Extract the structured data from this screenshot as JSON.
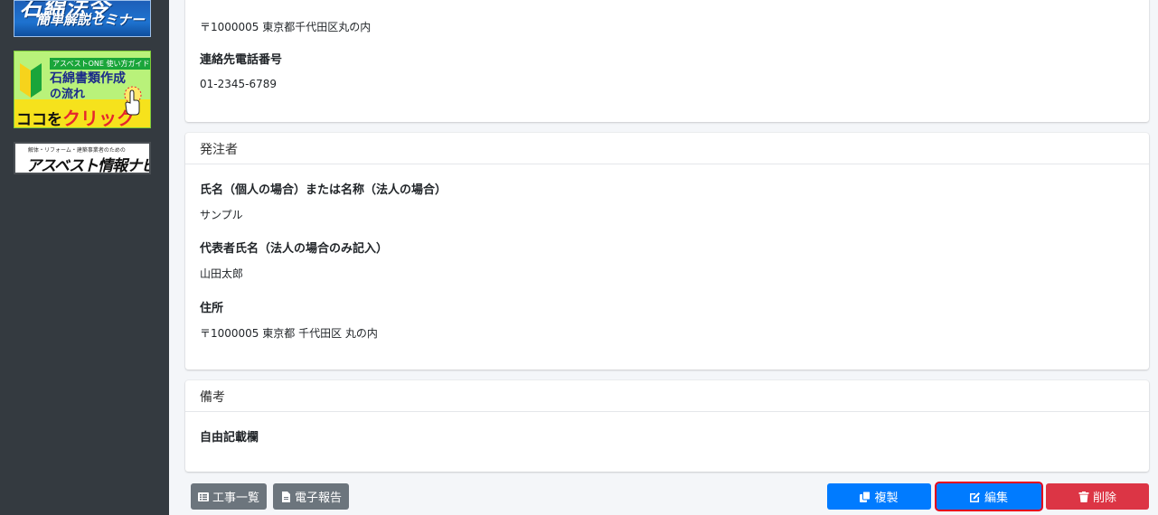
{
  "sidebar": {
    "banners": {
      "seminar_line1": "石綿法令",
      "seminar_line2": "簡単解説セミナー",
      "guide_tag": "アスベストONE 使い方ガイド",
      "guide_title1": "石綿書類作成",
      "guide_title2": "の流れ",
      "guide_click_prefix": "ココを",
      "guide_click_highlight": "クリック",
      "navi_small": "解体・リフォーム・建築事業者のための",
      "navi_title": "アスベスト情報ナビ"
    }
  },
  "contact_card": {
    "address_value": "〒1000005 東京都千代田区丸の内",
    "phone_label": "連絡先電話番号",
    "phone_value": "01-2345-6789"
  },
  "orderer_card": {
    "title": "発注者",
    "name_label": "氏名（個人の場合）または名称（法人の場合）",
    "name_value": "サンプル",
    "rep_label": "代表者氏名（法人の場合のみ記入）",
    "rep_value": "山田太郎",
    "address_label": "住所",
    "address_value": "〒1000005 東京都 千代田区 丸の内"
  },
  "notes_card": {
    "title": "備考",
    "free_label": "自由記載欄"
  },
  "actions": {
    "works_list": "工事一覧",
    "e_report": "電子報告",
    "copy": "複製",
    "edit": "編集",
    "delete": "削除"
  },
  "colors": {
    "sidebar_bg": "#343a40",
    "primary": "#007bff",
    "danger": "#dc3545",
    "secondary": "#6c757d",
    "highlight_outline": "#e4001b"
  }
}
